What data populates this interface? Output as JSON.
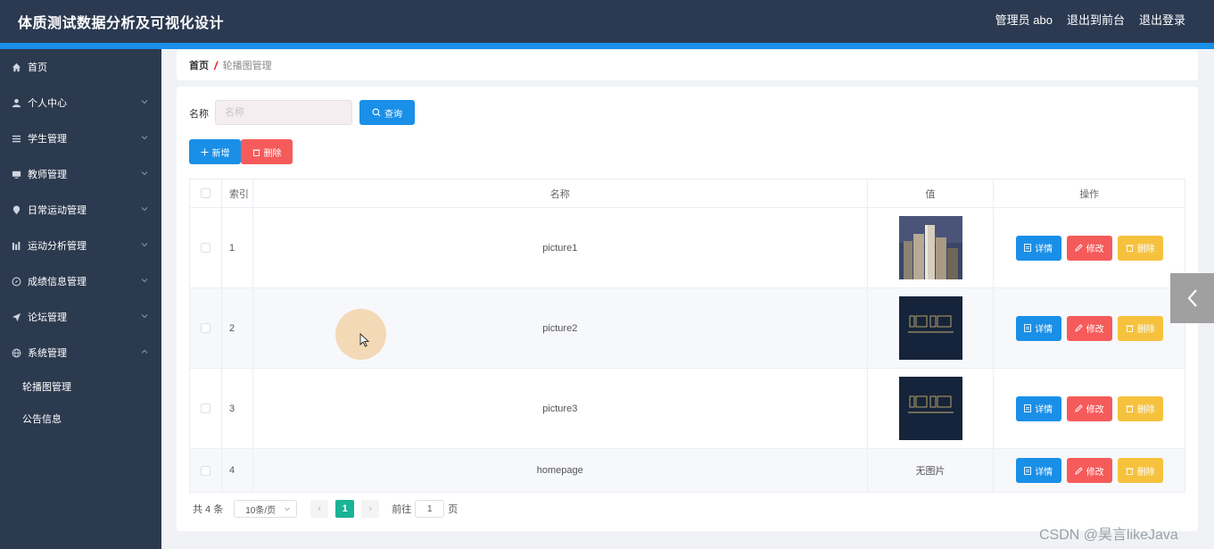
{
  "header": {
    "title": "体质测试数据分析及可视化设计",
    "user": "管理员 abo",
    "front": "退出到前台",
    "logout": "退出登录"
  },
  "sidebar": {
    "items": [
      {
        "label": "首页",
        "icon": "home-icon"
      },
      {
        "label": "个人中心",
        "icon": "user-icon"
      },
      {
        "label": "学生管理",
        "icon": "list-icon"
      },
      {
        "label": "教师管理",
        "icon": "monitor-icon"
      },
      {
        "label": "日常运动管理",
        "icon": "location-icon"
      },
      {
        "label": "运动分析管理",
        "icon": "chart-icon"
      },
      {
        "label": "成绩信息管理",
        "icon": "compass-icon"
      },
      {
        "label": "论坛管理",
        "icon": "send-icon"
      },
      {
        "label": "系统管理",
        "icon": "globe-icon"
      }
    ],
    "sub_items": [
      {
        "label": "轮播图管理"
      },
      {
        "label": "公告信息"
      }
    ]
  },
  "breadcrumb": {
    "home": "首页",
    "separator": "/",
    "current": "轮播图管理"
  },
  "search": {
    "label": "名称",
    "placeholder": "名称",
    "button": "查询"
  },
  "actions": {
    "add": "新增",
    "delete": "删除"
  },
  "table": {
    "headers": {
      "index": "索引",
      "name": "名称",
      "value": "值",
      "ops": "操作"
    },
    "rows": [
      {
        "index": "1",
        "name": "picture1",
        "value": "",
        "image": "architecture"
      },
      {
        "index": "2",
        "name": "picture2",
        "value": "",
        "image": "dark-logo"
      },
      {
        "index": "3",
        "name": "picture3",
        "value": "",
        "image": "dark-logo"
      },
      {
        "index": "4",
        "name": "homepage",
        "value": "无图片",
        "image": ""
      }
    ],
    "ops": {
      "detail": "详情",
      "edit": "修改",
      "delete": "删除"
    }
  },
  "pagination": {
    "total": "共 4 条",
    "page_size": "10条/页",
    "prev": "‹",
    "current": "1",
    "next": "›",
    "goto_prefix": "前往",
    "goto_value": "1",
    "goto_suffix": "页"
  },
  "watermark": "CSDN @昊言likeJava",
  "colors": {
    "header_bg": "#2b3a51",
    "accent": "#1a8fe8",
    "danger": "#f65b5b",
    "warning": "#f6c23e",
    "pager_active": "#1ab394"
  }
}
